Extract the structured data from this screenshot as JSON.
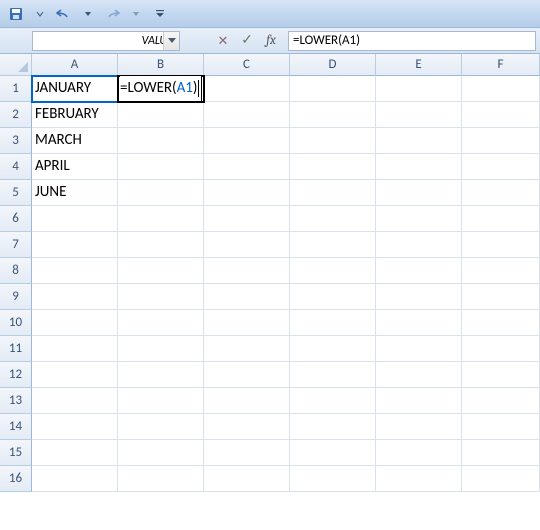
{
  "qat": {
    "save": "save-icon",
    "undo": "undo-icon",
    "redo": "redo-icon"
  },
  "name_box": {
    "value": "VALUE"
  },
  "formula_controls": {
    "cancel": "✕",
    "enter": "✓",
    "fx": "fx"
  },
  "formula_bar": {
    "value": "=LOWER(A1)"
  },
  "columns": [
    "A",
    "B",
    "C",
    "D",
    "E",
    "F"
  ],
  "col_widths": [
    "colA",
    "colB",
    "colC",
    "colD",
    "colE",
    "colF"
  ],
  "rows": [
    1,
    2,
    3,
    4,
    5,
    6,
    7,
    8,
    9,
    10,
    11,
    12,
    13,
    14,
    15,
    16
  ],
  "cells": {
    "A1": "JANUARY",
    "A2": "FEBRUARY",
    "A3": "MARCH",
    "A4": "APRIL",
    "A5": "JUNE"
  },
  "editing": {
    "cell": "B1",
    "prefix": "=LOWER(",
    "ref": "A1",
    "suffix": ")",
    "ref_cell": "A1"
  }
}
